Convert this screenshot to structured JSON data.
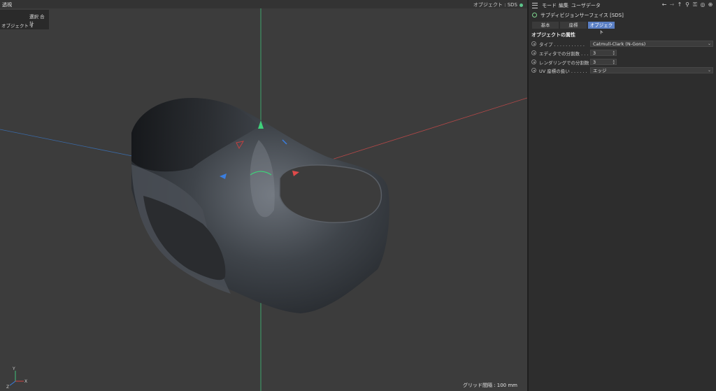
{
  "viewport": {
    "label": "透視",
    "right_label": "オブジェクト : SDS",
    "hud": {
      "select_total": "選択 合計",
      "objects": "オブジェクト  1"
    },
    "grid_info": "グリッド間隔 : 100 mm",
    "axis_labels": {
      "y": "Y",
      "x": "X",
      "z": "Z"
    }
  },
  "panel": {
    "menu": {
      "mode": "モード",
      "edit": "編集",
      "userdata": "ユーザデータ"
    },
    "object_title": "サブディビジョンサーフェイス [SDS]",
    "tabs": [
      {
        "label": "基本"
      },
      {
        "label": "座標"
      },
      {
        "label": "オブジェクト"
      }
    ],
    "section_title": "オブジェクトの属性",
    "props": {
      "type": {
        "label": "タイプ . . . . . . . . . . .",
        "value": "Catmull-Clark (N-Gons)"
      },
      "editor_subdiv": {
        "label": "エディタでの分割数 . . .",
        "value": "3"
      },
      "render_subdiv": {
        "label": "レンダリングでの分割数",
        "value": "3"
      },
      "uv_mode": {
        "label": "UV 座標の扱い . . . . . .",
        "value": "エッジ"
      }
    }
  },
  "colors": {
    "accent": "#5a7fc4",
    "object_icon": "#7fd68f"
  }
}
